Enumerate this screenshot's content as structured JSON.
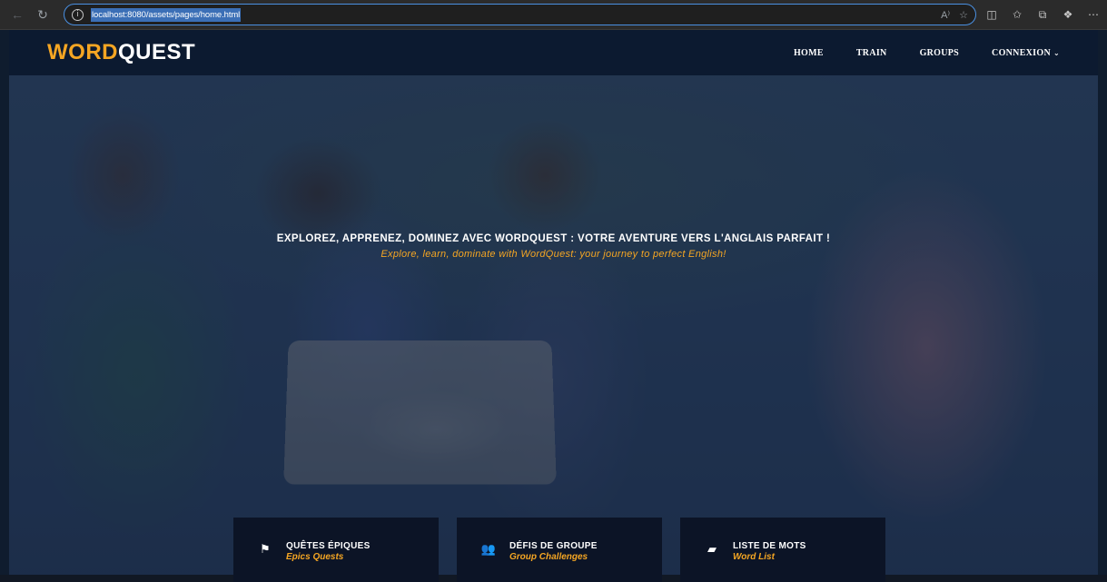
{
  "browser": {
    "url": "localhost:8080/assets/pages/home.html",
    "icons": [
      "back-icon",
      "reload-icon",
      "info-icon",
      "read-aloud-icon",
      "favorite-icon",
      "split-screen-icon",
      "favorites-icon",
      "collections-icon",
      "copilot-icon",
      "more-icon"
    ]
  },
  "header": {
    "logo_part1": "WORD",
    "logo_part2": "QUEST",
    "nav": {
      "home": "HOME",
      "train": "TRAIN",
      "groups": "GROUPS",
      "connexion": "CONNEXION"
    }
  },
  "hero": {
    "title": "EXPLOREZ, APPRENEZ, DOMINEZ AVEC WORDQUEST : VOTRE AVENTURE VERS L'ANGLAIS PARFAIT !",
    "subtitle": "Explore, learn, dominate with WordQuest: your journey to perfect English!"
  },
  "features": [
    {
      "title": "QUÊTES ÉPIQUES",
      "subtitle": "Epics Quests",
      "icon": "flag-icon"
    },
    {
      "title": "DÉFIS DE GROUPE",
      "subtitle": "Group Challenges",
      "icon": "users-icon"
    },
    {
      "title": "LISTE DE MOTS",
      "subtitle": "Word List",
      "icon": "book-icon"
    }
  ],
  "colors": {
    "accent": "#f5a623",
    "header_bg": "#0c1a30",
    "card_bg": "#0c1426"
  }
}
